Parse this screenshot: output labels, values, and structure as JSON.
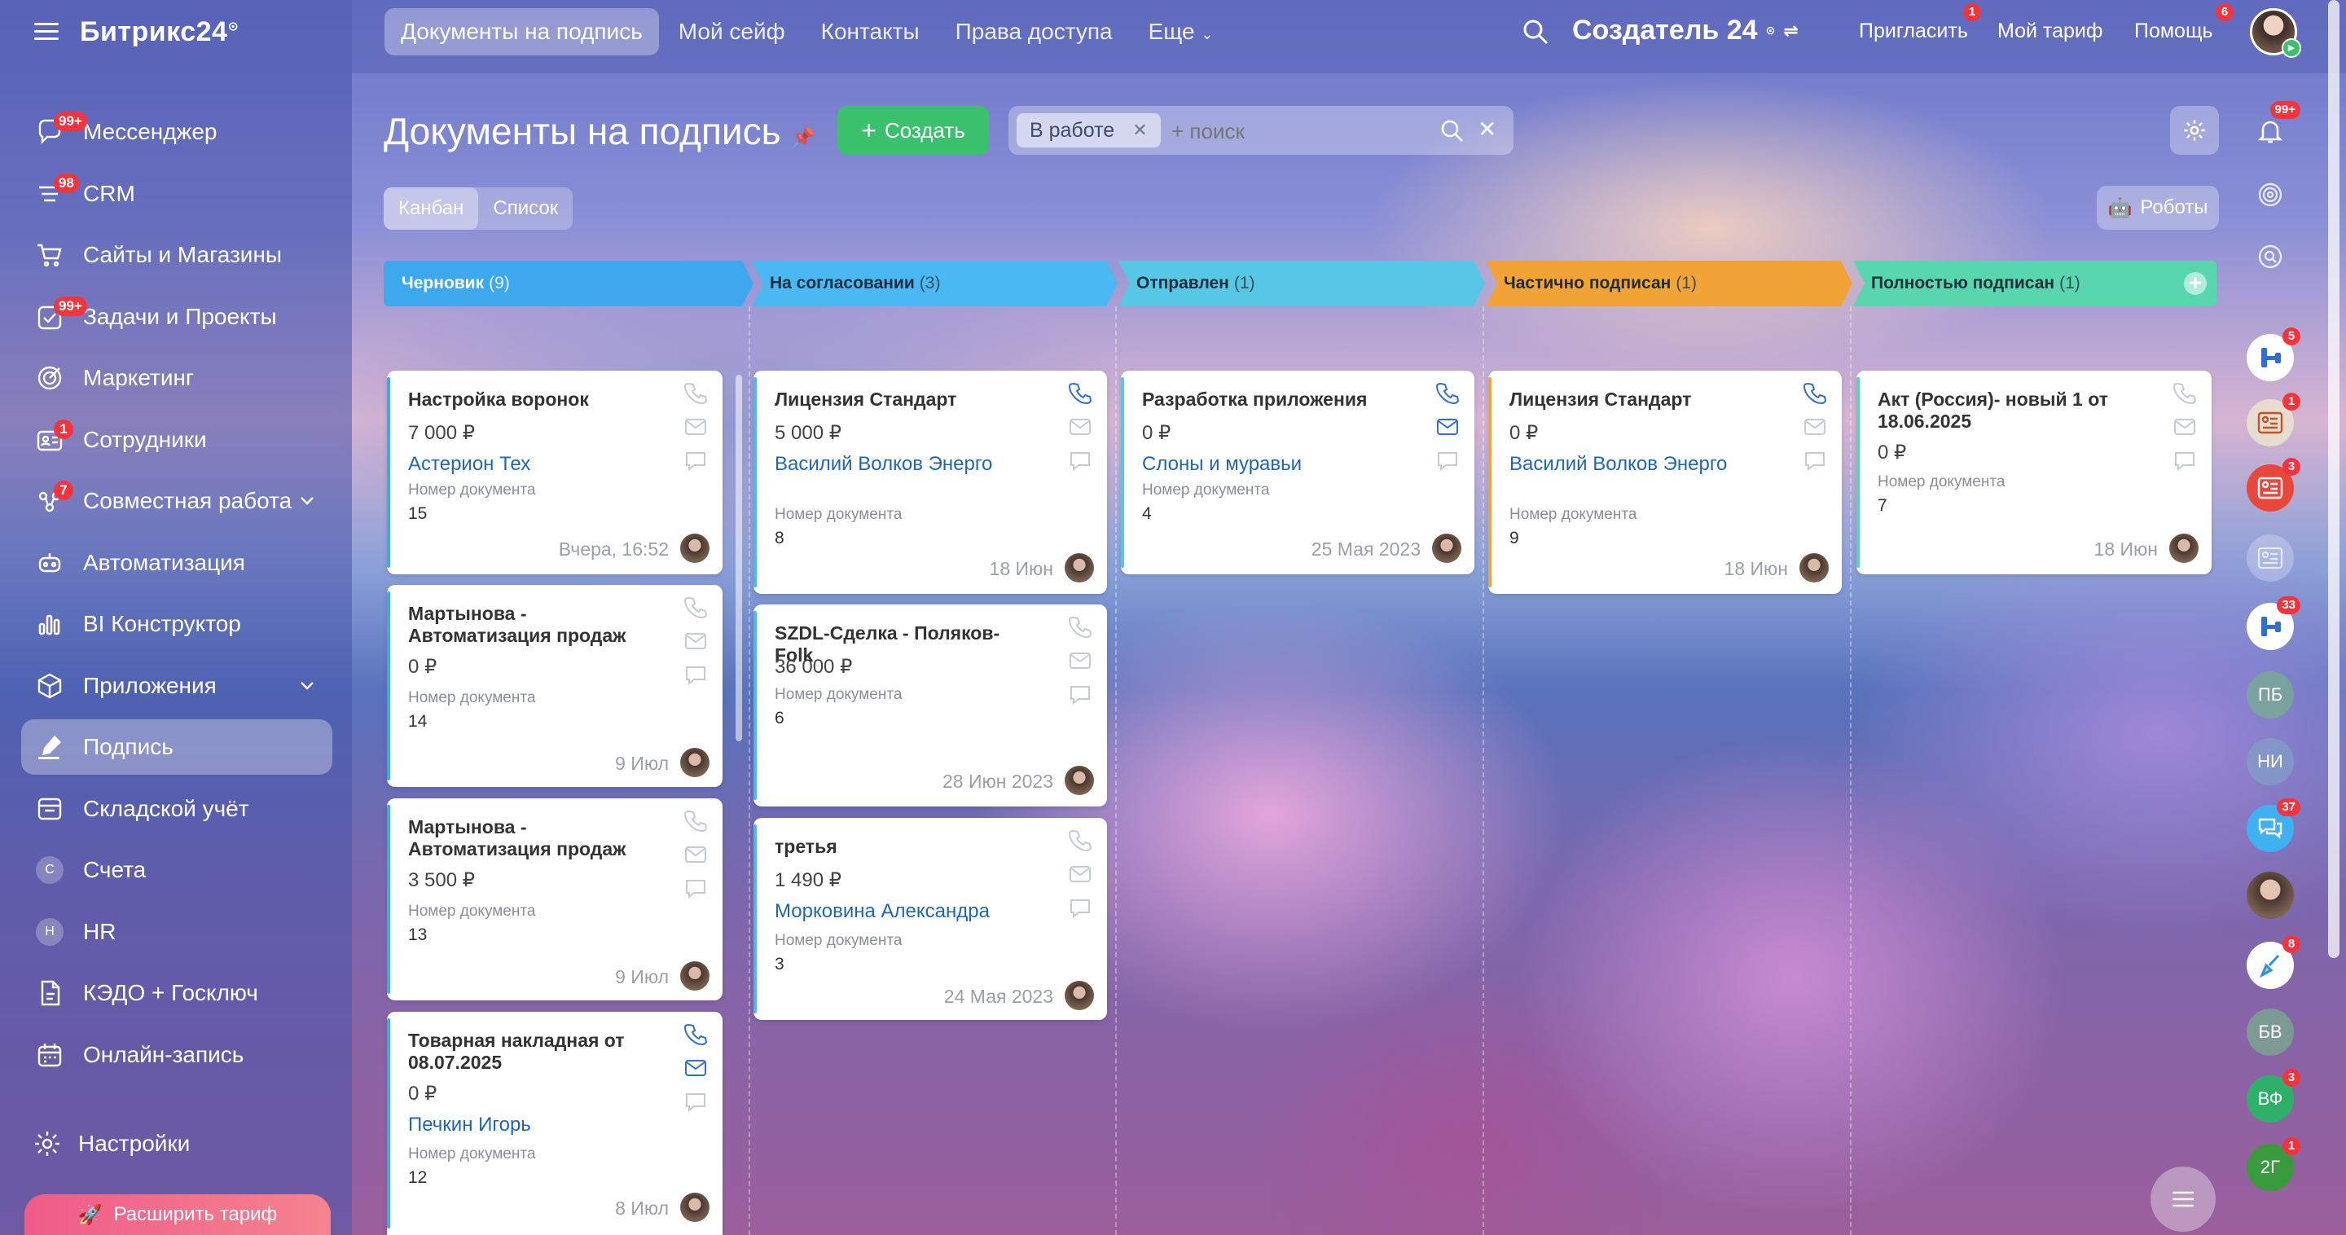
{
  "sidebar": {
    "logo": "Битрикс24",
    "items": [
      {
        "label": "Мессенджер",
        "badge": "99+",
        "icon": "chat-icon"
      },
      {
        "label": "CRM",
        "badge": "98",
        "icon": "crm-icon"
      },
      {
        "label": "Сайты и Магазины",
        "badge": "",
        "icon": "cart-icon"
      },
      {
        "label": "Задачи и Проекты",
        "badge": "99+",
        "icon": "tasks-icon"
      },
      {
        "label": "Маркетинг",
        "badge": "",
        "icon": "target-icon"
      },
      {
        "label": "Сотрудники",
        "badge": "1",
        "icon": "employees-icon"
      },
      {
        "label": "Совместная работа",
        "badge": "7",
        "icon": "collab-icon"
      },
      {
        "label": "Автоматизация",
        "badge": "",
        "icon": "robot-icon"
      },
      {
        "label": "BI Конструктор",
        "badge": "",
        "icon": "bi-chart-icon"
      },
      {
        "label": "Приложения",
        "badge": "",
        "icon": "apps-icon"
      },
      {
        "label": "Подпись",
        "badge": "",
        "icon": "sign-pen-icon"
      },
      {
        "label": "Складской учёт",
        "badge": "",
        "icon": "warehouse-icon"
      },
      {
        "label": "Счета",
        "badge": "",
        "icon": "letter-c-icon",
        "letter": "С"
      },
      {
        "label": "HR",
        "badge": "",
        "icon": "letter-h-icon",
        "letter": "H"
      },
      {
        "label": "КЭДО + Госключ",
        "badge": "",
        "icon": "document-icon"
      },
      {
        "label": "Онлайн-запись",
        "badge": "",
        "icon": "calendar-icon"
      }
    ],
    "settings": "Настройки",
    "upgrade": "Расширить тариф"
  },
  "topbar": {
    "tabs": [
      "Документы на подпись",
      "Мой сейф",
      "Контакты",
      "Права доступа",
      "Еще"
    ],
    "creator": "Создатель 24",
    "invite": "Пригласить",
    "invite_badge": "1",
    "tariff": "Мой тариф",
    "help": "Помощь",
    "help_badge": "6"
  },
  "page": {
    "title": "Документы на подпись",
    "create": "Создать",
    "filter_chip": "В работе",
    "search_placeholder": "+ поиск",
    "view_kanban": "Канбан",
    "view_list": "Список",
    "robots": "Роботы"
  },
  "columns": [
    {
      "title": "Черновик",
      "count": "(9)",
      "color": "#3ea8ef"
    },
    {
      "title": "На согласовании",
      "count": "(3)",
      "color": "#4ab8f3"
    },
    {
      "title": "Отправлен",
      "count": "(1)",
      "color": "#56c8e6"
    },
    {
      "title": "Частично подписан",
      "count": "(1)",
      "color": "#f2a335"
    },
    {
      "title": "Полностью подписан",
      "count": "(1)",
      "color": "#58d6ae"
    }
  ],
  "doc_number_label": "Номер документа",
  "cards": [
    {
      "title": "Настройка воронок",
      "sum": "7 000 ₽",
      "client": "Астерион Тех",
      "num": "15",
      "date": "Вчера, 16:52"
    },
    {
      "title": "Мартынова - Автоматизация продаж",
      "sum": "0 ₽",
      "client": "",
      "num": "14",
      "date": "9 Июл"
    },
    {
      "title": "Мартынова - Автоматизация продаж",
      "sum": "3 500 ₽",
      "client": "",
      "num": "13",
      "date": "9 Июл"
    },
    {
      "title": "Товарная накладная от 08.07.2025",
      "sum": "0 ₽",
      "client": "Печкин Игорь",
      "num": "12",
      "date": "8 Июл"
    },
    {
      "title": "Лицензия Стандарт",
      "sum": "5 000 ₽",
      "client": "Василий Волков Энерго",
      "num": "8",
      "date": "18 Июн"
    },
    {
      "title": "SZDL-Сделка - Поляков-Folk",
      "sum": "36 000 ₽",
      "client": "",
      "num": "6",
      "date": "28 Июн 2023"
    },
    {
      "title": "третья",
      "sum": "1 490 ₽",
      "client": "Морковина Александра",
      "num": "3",
      "date": "24 Мая 2023"
    },
    {
      "title": "Разработка приложения",
      "sum": "0 ₽",
      "client": "Слоны и муравьи",
      "num": "4",
      "date": "25 Мая 2023"
    },
    {
      "title": "Лицензия Стандарт",
      "sum": "0 ₽",
      "client": "Василий Волков Энерго",
      "num": "9",
      "date": "18 Июн"
    },
    {
      "title": "Акт (Россия)- новый 1 от 18.06.2025",
      "sum": "0 ₽",
      "client": "",
      "num": "7",
      "date": "18 Июн"
    }
  ],
  "rail": [
    {
      "icon": "bell-icon",
      "badge": "99+",
      "text": ""
    },
    {
      "icon": "target-icon",
      "badge": "",
      "text": ""
    },
    {
      "icon": "search-chat-icon",
      "badge": "",
      "text": ""
    },
    {
      "icon": "flow-icon",
      "badge": "5",
      "text": ""
    },
    {
      "icon": "contact-card-icon",
      "badge": "1",
      "text": ""
    },
    {
      "icon": "contact-card-icon",
      "badge": "3",
      "text": ""
    },
    {
      "icon": "contact-card-icon",
      "badge": "",
      "text": ""
    },
    {
      "icon": "flow-icon",
      "badge": "33",
      "text": ""
    },
    {
      "icon": "avatar-initials",
      "badge": "",
      "text": "ПБ"
    },
    {
      "icon": "avatar-initials",
      "badge": "",
      "text": "НИ"
    },
    {
      "icon": "chat-bubbles-icon",
      "badge": "37",
      "text": ""
    },
    {
      "icon": "avatar-photo",
      "badge": "",
      "text": ""
    },
    {
      "icon": "broom-icon",
      "badge": "8",
      "text": ""
    },
    {
      "icon": "avatar-initials",
      "badge": "",
      "text": "БВ"
    },
    {
      "icon": "avatar-initials",
      "badge": "3",
      "text": "ВФ"
    },
    {
      "icon": "avatar-initials",
      "badge": "1",
      "text": "2Г"
    }
  ]
}
